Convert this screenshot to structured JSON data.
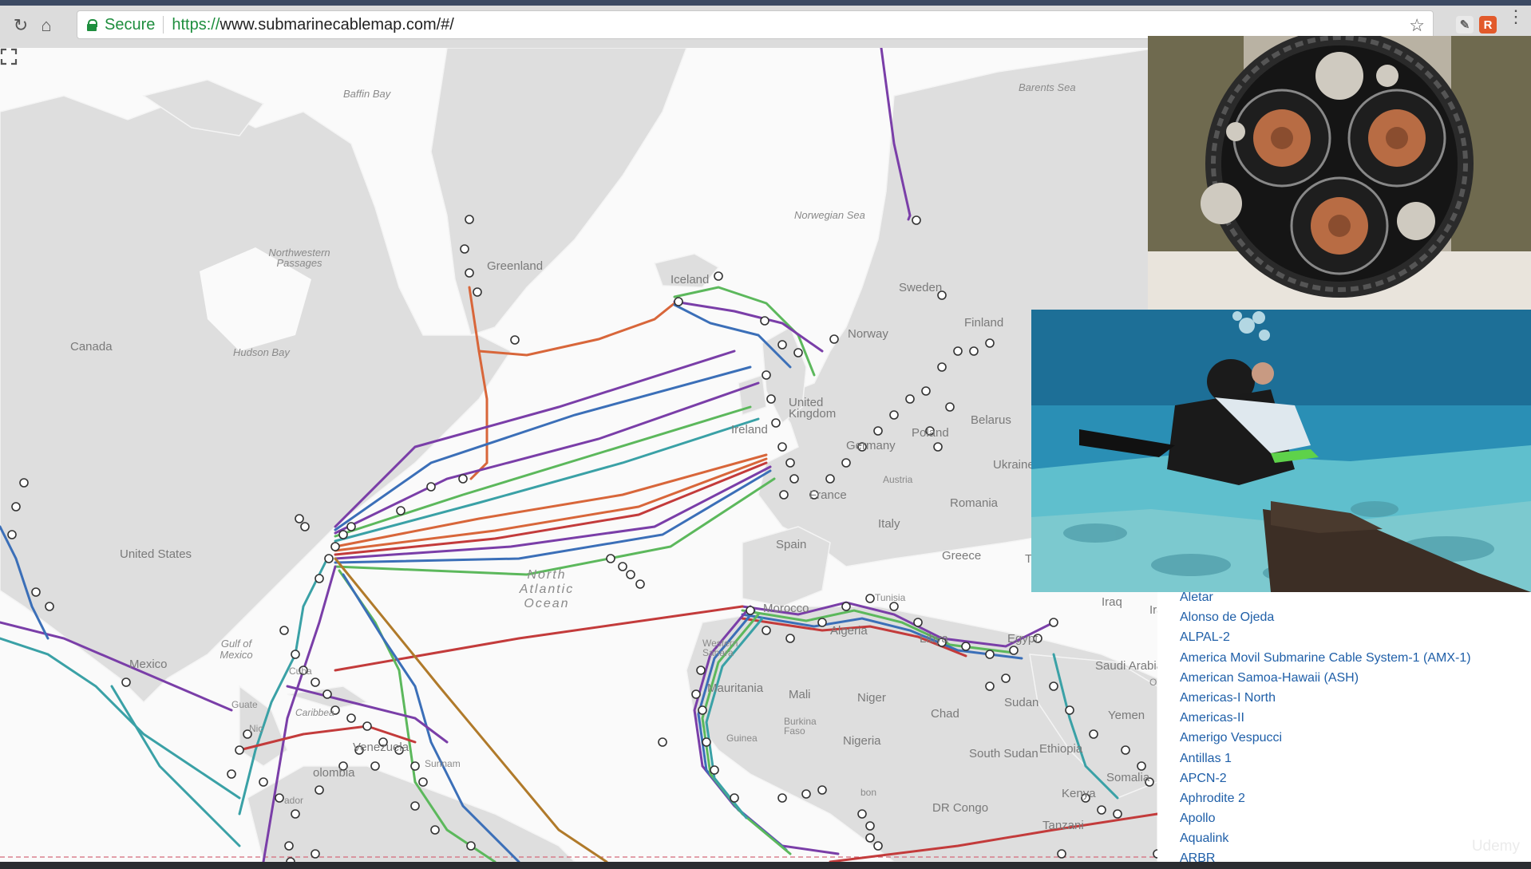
{
  "browser": {
    "secure_label": "Secure",
    "url_scheme": "https://",
    "url_rest": "www.submarinecablemap.com/#/",
    "extension_letter": "R"
  },
  "map": {
    "labels": {
      "baffin_bay": "Baffin Bay",
      "barents_sea": "Barents Sea",
      "norwegian_sea": "Norwegian Sea",
      "northwestern_passages": "Northwestern Passages",
      "greenland": "Greenland",
      "iceland": "Iceland",
      "sweden": "Sweden",
      "finland": "Finland",
      "norway": "Norway",
      "canada": "Canada",
      "hudson_bay": "Hudson Bay",
      "ireland": "Ireland",
      "united_kingdom": "United Kingdom",
      "germany": "Germany",
      "poland": "Poland",
      "belarus": "Belarus",
      "ukraine": "Ukraine",
      "austria": "Austria",
      "france": "France",
      "romania": "Romania",
      "italy": "Italy",
      "spain": "Spain",
      "greece": "Greece",
      "turkey": "Turke",
      "united_states": "United States",
      "north_atlantic_ocean": "North Atlantic Ocean",
      "tunisia": "Tunisia",
      "morocco": "Morocco",
      "algeria": "Algeria",
      "libya": "Libya",
      "egypt": "Egypt",
      "iraq": "Iraq",
      "iran": "Iran",
      "saudi_arabia": "Saudi Arabia",
      "oman": "Oman",
      "yemen": "Yemen",
      "gulf_of_mexico": "Gulf of Mexico",
      "mexico": "Mexico",
      "cuba": "Cuba",
      "western_sahara": "Western Sahara",
      "mauritania": "Mauritania",
      "mali": "Mali",
      "niger": "Niger",
      "chad": "Chad",
      "sudan": "Sudan",
      "guatemala": "Guate",
      "caribbean": "Caribbea",
      "nicaragua": "Nic",
      "venezuela": "Venezuela",
      "burkina_faso": "Burkina Faso",
      "guinea": "Guinea",
      "nigeria": "Nigeria",
      "ethiopia": "Ethiopia",
      "south_sudan": "South Sudan",
      "somalia": "Somalia",
      "colombia": "olombia",
      "ecuador": "ador",
      "suriname": "Surinam",
      "kenya": "Kenya",
      "dr_congo": "DR Congo",
      "gabon": "bon",
      "tanzania": "Tanzani"
    }
  },
  "sidebar": {
    "cables": [
      "Aletar",
      "Alonso de Ojeda",
      "ALPAL-2",
      "America Movil Submarine Cable System-1 (AMX-1)",
      "American Samoa-Hawaii (ASH)",
      "Americas-I North",
      "Americas-II",
      "Amerigo Vespucci",
      "Antillas 1",
      "APCN-2",
      "Aphrodite 2",
      "Apollo",
      "Aqualink",
      "ARBR"
    ]
  },
  "watermark": "Udemy",
  "colors": {
    "land": "#dedede",
    "water": "#fafafa",
    "link": "#1f5fa8",
    "secure": "#1e8e3e",
    "cable_orange": "#d8663a",
    "cable_purple": "#7a3ea8",
    "cable_green": "#5cb85c",
    "cable_blue": "#3b6fb8",
    "cable_teal": "#3aa1a6",
    "cable_red": "#c33b3b"
  }
}
